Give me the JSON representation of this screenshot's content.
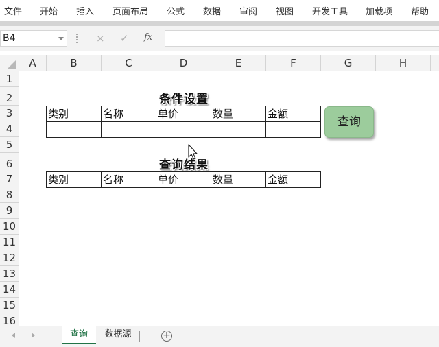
{
  "ribbon": {
    "tabs": [
      "文件",
      "开始",
      "插入",
      "页面布局",
      "公式",
      "数据",
      "审阅",
      "视图",
      "开发工具",
      "加载项",
      "帮助"
    ]
  },
  "formula_bar": {
    "name_box": "B4",
    "cancel_icon": "×",
    "confirm_icon": "✓",
    "fx_label": "fx",
    "formula": ""
  },
  "grid": {
    "columns": [
      "A",
      "B",
      "C",
      "D",
      "E",
      "F",
      "G",
      "H"
    ],
    "rows": [
      "1",
      "2",
      "3",
      "4",
      "5",
      "6",
      "7",
      "8",
      "9",
      "10",
      "11",
      "12",
      "13",
      "14",
      "15",
      "16"
    ]
  },
  "condition_section": {
    "title": "条件设置",
    "headers": [
      "类别",
      "名称",
      "单价",
      "数量",
      "金额"
    ],
    "inputs": [
      "",
      "",
      "",
      "",
      ""
    ]
  },
  "result_section": {
    "title": "查询结果",
    "headers": [
      "类别",
      "名称",
      "单价",
      "数量",
      "金额"
    ]
  },
  "query_button": {
    "label": "查询",
    "color": "#9ccc9c"
  },
  "sheet_tabs": {
    "tabs": [
      "查询",
      "数据源"
    ],
    "active": "查询",
    "accent": "#217346",
    "add_icon": "+"
  }
}
